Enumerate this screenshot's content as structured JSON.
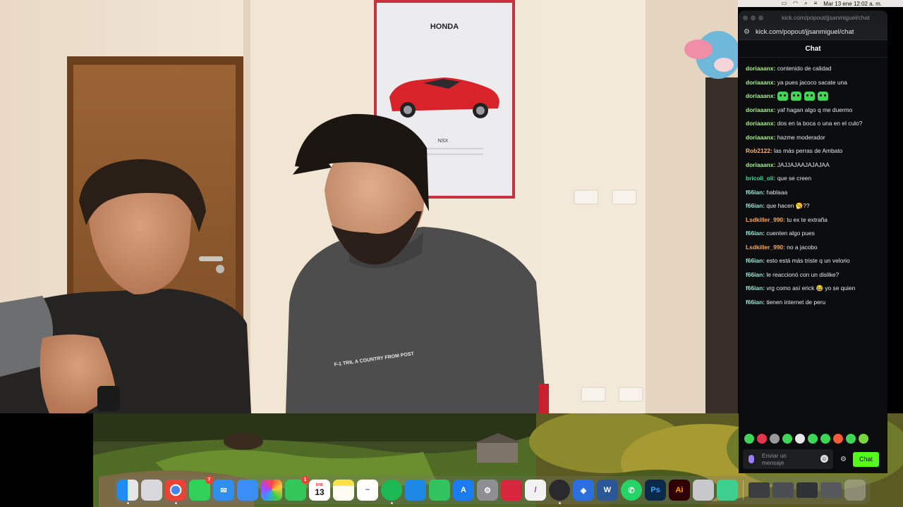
{
  "menubar": {
    "date_time": "Mar 13 ene   12:02 a. m."
  },
  "popout": {
    "title": "kick.com/popout/jjsanmiguel/chat",
    "url": "kick.com/popout/jjsanmiguel/chat",
    "chat_header": "Chat",
    "messages": [
      {
        "user": "doriaaanx:",
        "color": "#a6f08a",
        "text": "contenido de calidad",
        "emotes": 0
      },
      {
        "user": "doriaaanx:",
        "color": "#a6f08a",
        "text": "ya pues jacoco sacate una",
        "emotes": 0
      },
      {
        "user": "doriaaanx:",
        "color": "#a6f08a",
        "text": "",
        "emotes": 4
      },
      {
        "user": "doriaaanx:",
        "color": "#a6f08a",
        "text": "yaf hagan algo q me duermo",
        "emotes": 0
      },
      {
        "user": "doriaaanx:",
        "color": "#a6f08a",
        "text": "dos en la boca o una en el culo?",
        "emotes": 0
      },
      {
        "user": "doriaaanx:",
        "color": "#a6f08a",
        "text": "hazme moderador",
        "emotes": 0
      },
      {
        "user": "Rob2122:",
        "color": "#f2b279",
        "text": "las más perras de Ambato",
        "emotes": 0
      },
      {
        "user": "doriaaanx:",
        "color": "#a6f08a",
        "text": "JAJJAJAAJAJAJAA",
        "emotes": 0
      },
      {
        "user": "bricoli_oli:",
        "color": "#3ddc97",
        "text": "que se creen",
        "emotes": 0
      },
      {
        "user": "f66ian:",
        "color": "#9be3d0",
        "text": "hablaaa",
        "emotes": 0
      },
      {
        "user": "f66ian:",
        "color": "#9be3d0",
        "text": "que hacen 🥱??",
        "emotes": 0
      },
      {
        "user": "Lsdkiller_990:",
        "color": "#f5a855",
        "text": "tu ex te extraña",
        "emotes": 0
      },
      {
        "user": "f66ian:",
        "color": "#9be3d0",
        "text": "cuenten algo pues",
        "emotes": 0
      },
      {
        "user": "Lsdkiller_990:",
        "color": "#f5a855",
        "text": "no a jacobo",
        "emotes": 0
      },
      {
        "user": "f66ian:",
        "color": "#9be3d0",
        "text": "esto está más triste q un velorio",
        "emotes": 0
      },
      {
        "user": "f66ian:",
        "color": "#9be3d0",
        "text": "le reaccionó con un dislike?",
        "emotes": 0
      },
      {
        "user": "f66ian:",
        "color": "#9be3d0",
        "text": "vrg como así erick 😂 yo se quien",
        "emotes": 0
      },
      {
        "user": "f66ian:",
        "color": "#9be3d0",
        "text": "tienen internet de peru",
        "emotes": 0
      }
    ],
    "input_placeholder": "Enviar un mensaje",
    "send_label": "Chat",
    "accent": "#53fc18"
  },
  "dock": {
    "calendar_month": "ENE",
    "calendar_day": "13",
    "messages_badge": "7",
    "facetime_badge": "1"
  },
  "scene": {
    "poster_brand": "HONDA",
    "poster_model": "NSX",
    "sweatshirt_print": "F-1 TRIL A COUNTRY FROM POST"
  }
}
